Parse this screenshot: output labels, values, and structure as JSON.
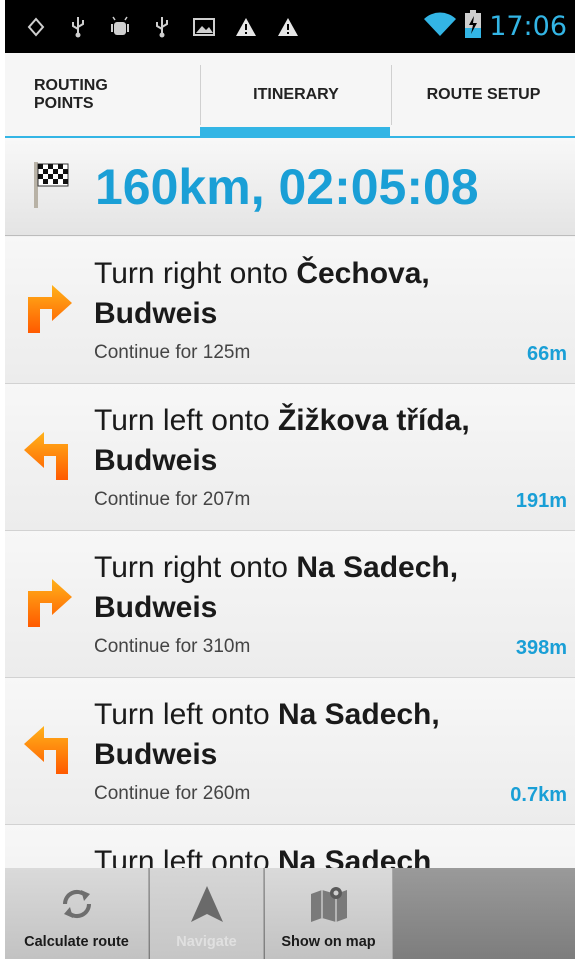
{
  "status_bar": {
    "time": "17:06"
  },
  "tabs": [
    {
      "label_line1": "ROUTING",
      "label_line2": "POINTS"
    },
    {
      "label": "ITINERARY"
    },
    {
      "label": "ROUTE SETUP"
    }
  ],
  "summary": {
    "text": "160km, 02:05:08"
  },
  "itinerary": [
    {
      "prefix": "Turn right onto ",
      "street": "Čechova,",
      "city": "Budweis",
      "continue": "Continue for 125m",
      "distance": "66m",
      "direction": "right"
    },
    {
      "prefix": "Turn left onto ",
      "street": "Žižkova třída,",
      "city": "Budweis",
      "continue": "Continue for 207m",
      "distance": "191m",
      "direction": "left"
    },
    {
      "prefix": "Turn right onto ",
      "street": "Na Sadech,",
      "city": "Budweis",
      "continue": "Continue for 310m",
      "distance": "398m",
      "direction": "right"
    },
    {
      "prefix": "Turn left onto ",
      "street": "Na Sadech,",
      "city": "Budweis",
      "continue": "Continue for 260m",
      "distance": "0.7km",
      "direction": "left"
    },
    {
      "prefix": "Turn left onto ",
      "street": "Na Sadech",
      "city": "",
      "continue": "",
      "distance": "",
      "direction": "left"
    }
  ],
  "toolbar": {
    "calculate_label": "Calculate route",
    "navigate_label": "Navigate",
    "show_map_label": "Show on map"
  },
  "colors": {
    "accent": "#33b5e5",
    "summary_text": "#1a9fd6",
    "arrow": "#ff8a00"
  }
}
